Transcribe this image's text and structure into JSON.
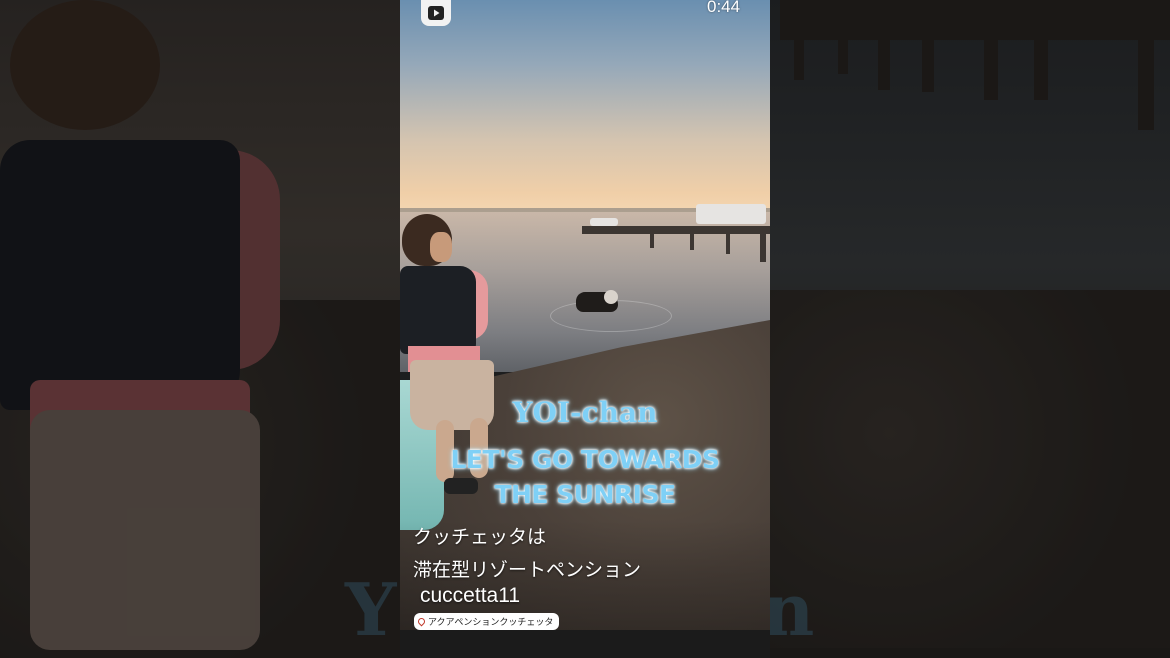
{
  "player": {
    "shorts_logo_icon": "youtube-shorts-icon",
    "time": "0:44"
  },
  "overlay_caption": {
    "title": "YOI-chan",
    "line1": "LET'S GO TOWARDS",
    "line2": "THE SUNRISE",
    "color": "#7fd0f6"
  },
  "description": {
    "line1": "クッチェッタは",
    "line2": "滞在型リゾートペンション",
    "channel": "cuccetta11"
  },
  "location_tag": {
    "icon": "location-pin-icon",
    "label": "アクアペンションクッチェッタ"
  },
  "background_ghost_text": {
    "left": "Y",
    "right": "n"
  }
}
